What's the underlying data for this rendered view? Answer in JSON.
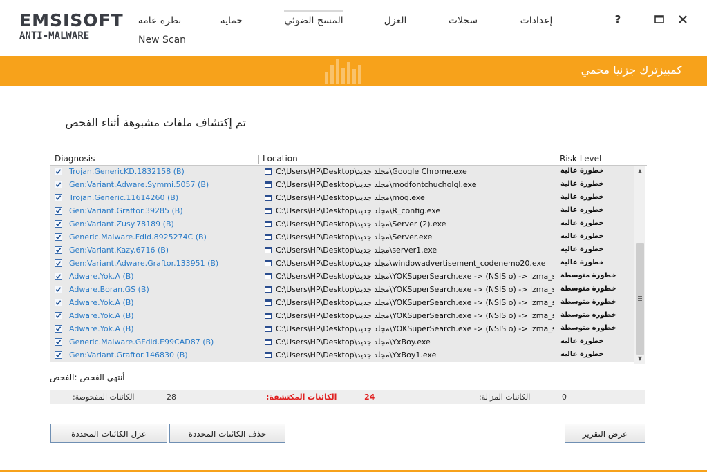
{
  "brand": {
    "logo_top": "EMSISOFT",
    "logo_bottom": "ANTI-MALWARE",
    "accent": "#f7a21b"
  },
  "nav": {
    "tabs": [
      {
        "label": "نظرة عامة"
      },
      {
        "label": "حماية"
      },
      {
        "label": "المسح الضوئي"
      },
      {
        "label": "العزل"
      },
      {
        "label": "سجلات"
      },
      {
        "label": "إعدادات"
      }
    ],
    "new_scan": "New Scan"
  },
  "window": {
    "help": "?",
    "maximize": "🗖",
    "close": "✕"
  },
  "banner": {
    "title": "كمبيزترك جزنيا محمي"
  },
  "heading": "تم إكتشاف ملفات مشبوهة أثناء الفحص",
  "grid": {
    "headers": {
      "diagnosis": "Diagnosis",
      "location": "Location",
      "risk": "Risk Level"
    },
    "rows": [
      {
        "diagnosis": "Trojan.GenericKD.1832158 (B)",
        "location": "C:\\Users\\HP\\Desktop\\مجلد جديد\\Google Chrome.exe",
        "risk": "خطورة عالية"
      },
      {
        "diagnosis": "Gen:Variant.Adware.Symmi.5057 (B)",
        "location": "C:\\Users\\HP\\Desktop\\مجلد جديد\\modfontchucholgl.exe",
        "risk": "خطورة عالية"
      },
      {
        "diagnosis": "Trojan.Generic.11614260 (B)",
        "location": "C:\\Users\\HP\\Desktop\\مجلد جديد\\moq.exe",
        "risk": "خطورة عالية"
      },
      {
        "diagnosis": "Gen:Variant.Graftor.39285 (B)",
        "location": "C:\\Users\\HP\\Desktop\\مجلد جديد\\R_config.exe",
        "risk": "خطورة عالية"
      },
      {
        "diagnosis": "Gen:Variant.Zusy.78189 (B)",
        "location": "C:\\Users\\HP\\Desktop\\مجلد جديد\\Server (2).exe",
        "risk": "خطورة عالية"
      },
      {
        "diagnosis": "Generic.Malware.Fdld.8925274C (B)",
        "location": "C:\\Users\\HP\\Desktop\\مجلد جديد\\Server.exe",
        "risk": "خطورة عالية"
      },
      {
        "diagnosis": "Gen:Variant.Kazy.6716 (B)",
        "location": "C:\\Users\\HP\\Desktop\\مجلد جديد\\server1.exe",
        "risk": "خطورة عالية"
      },
      {
        "diagnosis": "Gen:Variant.Adware.Graftor.133951 (B)",
        "location": "C:\\Users\\HP\\Desktop\\مجلد جديد\\windowadvertisement_codenemo20.exe",
        "risk": "خطورة عالية"
      },
      {
        "diagnosis": "Adware.Yok.A (B)",
        "location": "C:\\Users\\HP\\Desktop\\مجلد جديد\\YOKSuperSearch.exe -> (NSIS o) -> lzma_solid_ns",
        "risk": "خطورة متوسطة"
      },
      {
        "diagnosis": "Adware.Boran.GS (B)",
        "location": "C:\\Users\\HP\\Desktop\\مجلد جديد\\YOKSuperSearch.exe -> (NSIS o) -> lzma_solid_ns",
        "risk": "خطورة متوسطة"
      },
      {
        "diagnosis": "Adware.Yok.A (B)",
        "location": "C:\\Users\\HP\\Desktop\\مجلد جديد\\YOKSuperSearch.exe -> (NSIS o) -> lzma_solid_ns",
        "risk": "خطورة متوسطة"
      },
      {
        "diagnosis": "Adware.Yok.A (B)",
        "location": "C:\\Users\\HP\\Desktop\\مجلد جديد\\YOKSuperSearch.exe -> (NSIS o) -> lzma_solid_ns",
        "risk": "خطورة متوسطة"
      },
      {
        "diagnosis": "Adware.Yok.A (B)",
        "location": "C:\\Users\\HP\\Desktop\\مجلد جديد\\YOKSuperSearch.exe -> (NSIS o) -> lzma_solid_ns",
        "risk": "خطورة متوسطة"
      },
      {
        "diagnosis": "Generic.Malware.GFdld.E99CAD87 (B)",
        "location": "C:\\Users\\HP\\Desktop\\مجلد جديد\\YxBoy.exe",
        "risk": "خطورة عالية"
      },
      {
        "diagnosis": "Gen:Variant.Graftor.146830 (B)",
        "location": "C:\\Users\\HP\\Desktop\\مجلد جديد\\YxBoy1.exe",
        "risk": "خطورة عالية"
      }
    ]
  },
  "status": "أنتهى الفحص :الفحص",
  "stats": {
    "scanned_label": ":الكائنات المفحوصة",
    "scanned_value": "28",
    "detected_label": ":الكائنات المكتشفة",
    "detected_value": "24",
    "removed_label": ":الكائنات المزالة",
    "removed_value": "0",
    "detected_color": "#e02020"
  },
  "buttons": {
    "quarantine": "عزل الكائنات المحددة",
    "delete": "حذف الكائنات المحددة",
    "report": "عرض التقرير"
  }
}
